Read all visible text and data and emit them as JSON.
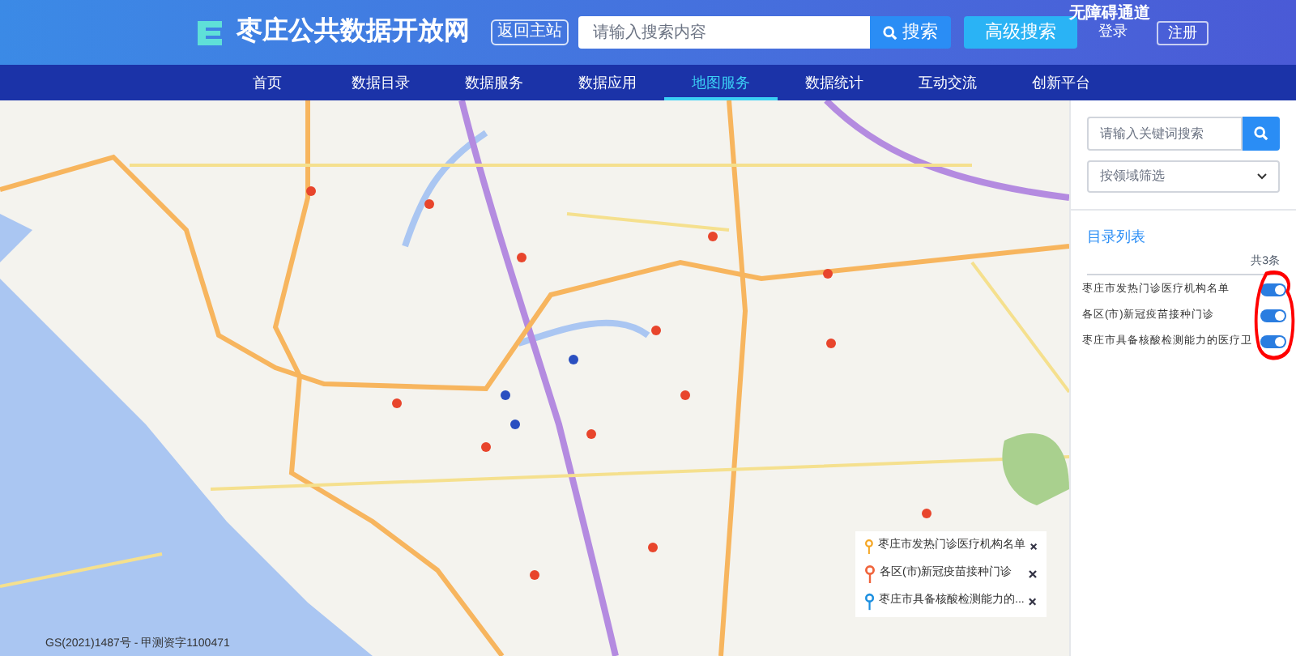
{
  "header": {
    "accessibility_link": "无障碍通道",
    "site_title": "枣庄公共数据开放网",
    "back_button": "返回主站",
    "search": {
      "placeholder": "请输入搜索内容",
      "button": "搜索"
    },
    "advanced_search": "高级搜索",
    "login": "登录",
    "register": "注册"
  },
  "nav": [
    {
      "label": "首页",
      "selected": false
    },
    {
      "label": "数据目录",
      "selected": false
    },
    {
      "label": "数据服务",
      "selected": false
    },
    {
      "label": "数据应用",
      "selected": false
    },
    {
      "label": "地图服务",
      "selected": true
    },
    {
      "label": "数据统计",
      "selected": false
    },
    {
      "label": "互动交流",
      "selected": false
    },
    {
      "label": "创新平台",
      "selected": false
    }
  ],
  "map": {
    "legend": [
      {
        "label": "枣庄市发热门诊医疗机构名单",
        "color": "#f5a623"
      },
      {
        "label": "各区(市)新冠疫苗接种门诊",
        "color": "#f0643c"
      },
      {
        "label": "枣庄市具备核酸检测能力的...",
        "color": "#1e90e0"
      }
    ],
    "copyright": "GS(2021)1487号 - 甲测资字1100471"
  },
  "panel": {
    "keyword_search": {
      "placeholder": "请输入关键词搜索"
    },
    "filter": "按领域筛选",
    "heading": "目录列表",
    "count": "共3条",
    "layers": [
      {
        "name": "枣庄市发热门诊医疗机构名单",
        "on": true
      },
      {
        "name": "各区(市)新冠疫苗接种门诊",
        "on": true
      },
      {
        "name": "枣庄市具备核酸检测能力的医疗卫",
        "on": true
      }
    ]
  }
}
